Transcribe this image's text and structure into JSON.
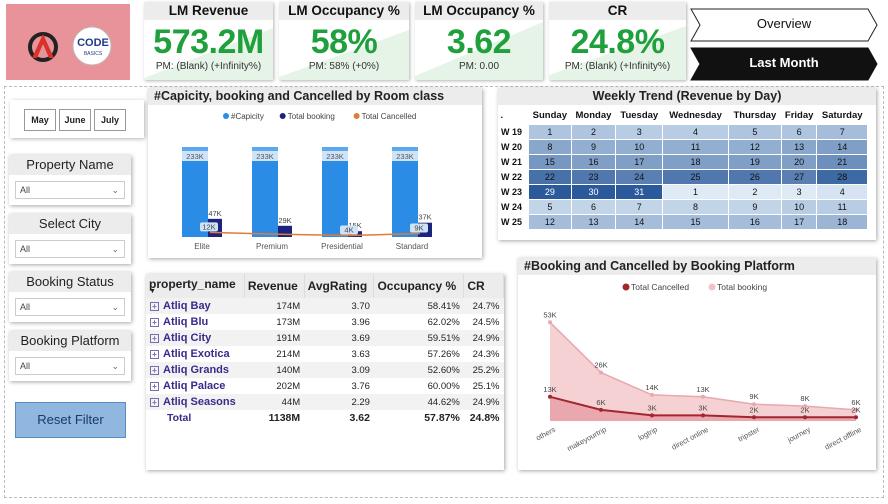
{
  "logo": {
    "code_text": "CODE",
    "basics_text": "BASICS"
  },
  "kpis": [
    {
      "title": "LM Revenue",
      "value": "573.2M",
      "prev": "PM: (Blank) (+Infinity%)"
    },
    {
      "title": "LM Occupancy %",
      "value": "58%",
      "prev": "PM: 58% (+0%)"
    },
    {
      "title": "LM Occupancy %",
      "value": "3.62",
      "prev": "PM: 0.00"
    },
    {
      "title": "CR",
      "value": "24.8%",
      "prev": "PM: (Blank) (+Infinity%)"
    }
  ],
  "nav": {
    "overview": "Overview",
    "last_month": "Last Month"
  },
  "months": [
    "May",
    "June",
    "July"
  ],
  "slicers": [
    {
      "title": "Property Name",
      "value": "All"
    },
    {
      "title": "Select City",
      "value": "All"
    },
    {
      "title": "Booking Status",
      "value": "All"
    },
    {
      "title": "Booking Platform",
      "value": "All"
    }
  ],
  "reset_label": "Reset Filter",
  "colors": {
    "capacity": "#2b8ce6",
    "booking": "#1a237e",
    "cancelled": "#e07b39",
    "kpi_green": "#1fa03c",
    "platform_booking": "#f2c2c6",
    "platform_cancelled": "#a3262f"
  },
  "chart_data": [
    {
      "type": "bar",
      "title": "#Capicity, booking and Cancelled by Room class",
      "categories": [
        "Elite",
        "Premium",
        "Presidential",
        "Standard"
      ],
      "series": [
        {
          "name": "#Capicity",
          "values": [
            233000,
            233000,
            233000,
            233000
          ],
          "labels": [
            "233K",
            "233K",
            "233K",
            "233K"
          ]
        },
        {
          "name": "Total booking",
          "values": [
            47000,
            29000,
            15000,
            37000
          ],
          "labels": [
            "47K",
            "29K",
            "15K",
            "37K"
          ]
        },
        {
          "name": "Total Cancelled",
          "values": [
            12000,
            7000,
            4000,
            9000
          ],
          "labels": [
            "12K",
            "",
            "4K",
            "9K"
          ]
        }
      ]
    },
    {
      "type": "heatmap",
      "title": "Weekly Trend (Revenue by Day)",
      "corner": ".",
      "columns": [
        "Sunday",
        "Monday",
        "Tuesday",
        "Wednesday",
        "Thursday",
        "Friday",
        "Saturday"
      ],
      "rows": [
        "W 19",
        "W 20",
        "W 21",
        "W 22",
        "W 23",
        "W 24",
        "W 25"
      ],
      "cells": [
        [
          1,
          2,
          3,
          4,
          5,
          6,
          7
        ],
        [
          8,
          9,
          10,
          11,
          12,
          13,
          14
        ],
        [
          15,
          16,
          17,
          18,
          19,
          20,
          21
        ],
        [
          22,
          23,
          24,
          25,
          26,
          27,
          28
        ],
        [
          29,
          30,
          31,
          1,
          2,
          3,
          4
        ],
        [
          5,
          6,
          7,
          8,
          9,
          10,
          11
        ],
        [
          12,
          13,
          14,
          15,
          16,
          17,
          18
        ]
      ],
      "intensity": [
        [
          0.25,
          0.25,
          0.2,
          0.2,
          0.25,
          0.25,
          0.3
        ],
        [
          0.45,
          0.4,
          0.4,
          0.4,
          0.4,
          0.45,
          0.5
        ],
        [
          0.55,
          0.5,
          0.5,
          0.5,
          0.5,
          0.5,
          0.6
        ],
        [
          0.8,
          0.75,
          0.7,
          0.75,
          0.75,
          0.7,
          0.85
        ],
        [
          0.95,
          0.95,
          0.95,
          0.0,
          0.0,
          0.0,
          0.05
        ],
        [
          0.15,
          0.15,
          0.15,
          0.15,
          0.15,
          0.2,
          0.2
        ],
        [
          0.3,
          0.3,
          0.3,
          0.3,
          0.3,
          0.3,
          0.35
        ]
      ]
    },
    {
      "type": "table",
      "columns": [
        "property_name",
        "Revenue",
        "AvgRating",
        "Occupancy %",
        "CR"
      ],
      "rows": [
        [
          "Atliq Bay",
          "174M",
          "3.70",
          "58.41%",
          "24.7%"
        ],
        [
          "Atliq Blu",
          "173M",
          "3.96",
          "62.02%",
          "24.5%"
        ],
        [
          "Atliq City",
          "191M",
          "3.69",
          "59.51%",
          "24.9%"
        ],
        [
          "Atliq Exotica",
          "214M",
          "3.63",
          "57.26%",
          "24.3%"
        ],
        [
          "Atliq Grands",
          "140M",
          "3.09",
          "52.60%",
          "25.2%"
        ],
        [
          "Atliq Palace",
          "202M",
          "3.76",
          "60.00%",
          "25.1%"
        ],
        [
          "Atliq Seasons",
          "44M",
          "2.29",
          "44.62%",
          "24.9%"
        ]
      ],
      "total": [
        "Total",
        "1138M",
        "3.62",
        "57.87%",
        "24.8%"
      ]
    },
    {
      "type": "area",
      "title": "#Booking and Cancelled by Booking Platform",
      "categories": [
        "others",
        "makeyourtrip",
        "logtrip",
        "direct online",
        "tripster",
        "journey",
        "direct offline"
      ],
      "series": [
        {
          "name": "Total Cancelled",
          "values": [
            13000,
            6000,
            3000,
            3000,
            2000,
            2000,
            2000
          ],
          "labels": [
            "13K",
            "6K",
            "3K",
            "3K",
            "2K",
            "2K",
            "2K"
          ]
        },
        {
          "name": "Total booking",
          "values": [
            53000,
            26000,
            14000,
            13000,
            9000,
            8000,
            6000
          ],
          "labels": [
            "53K",
            "26K",
            "14K",
            "13K",
            "9K",
            "8K",
            "6K"
          ]
        }
      ]
    }
  ]
}
